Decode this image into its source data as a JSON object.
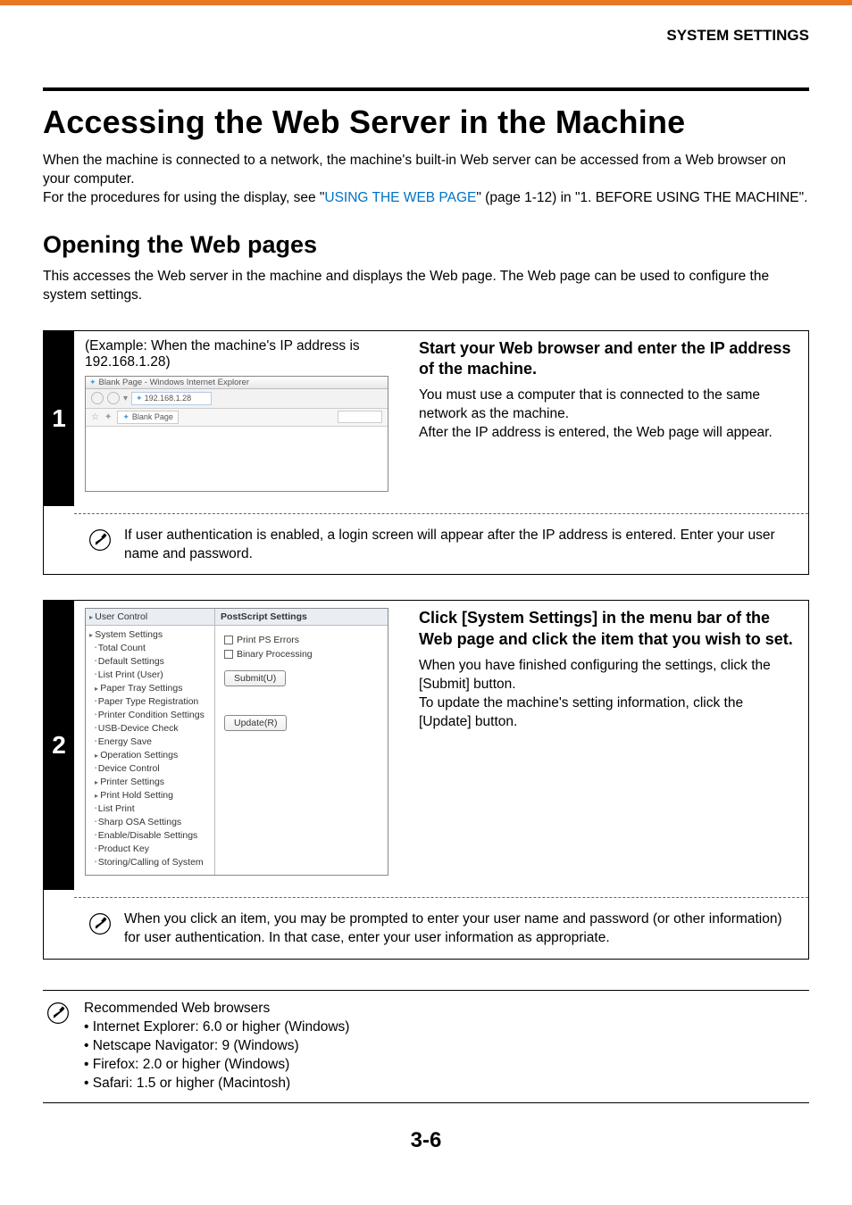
{
  "header": {
    "section": "SYSTEM SETTINGS"
  },
  "title": "Accessing the Web Server in the Machine",
  "intro": {
    "p1": "When the machine is connected to a network, the machine's built-in Web server can be accessed from a Web browser on your computer.",
    "p2a": "For the procedures for using the display, see \"",
    "link": "USING THE WEB PAGE",
    "p2b": "\" (page 1-12) in \"1. BEFORE USING THE MACHINE\"."
  },
  "subheading": "Opening the Web pages",
  "subintro": "This accesses the Web server in the machine and displays the Web page. The Web page can be used to configure the system settings.",
  "step1": {
    "num": "1",
    "example_label": "(Example: When the machine's IP address is 192.168.1.28)",
    "browser": {
      "title": "Blank Page - Windows Internet Explorer",
      "url": "192.168.1.28",
      "tab": "Blank Page"
    },
    "heading": "Start your Web browser and enter the IP address of the machine.",
    "body1": "You must use a computer that is connected to the same network as the machine.",
    "body2": "After the IP address is entered, the Web page will appear.",
    "note": "If user authentication is enabled, a login screen will appear after the IP address is entered. Enter your user name and password."
  },
  "step2": {
    "num": "2",
    "mock": {
      "left_header": "User Control",
      "right_header": "PostScript Settings",
      "menu": [
        {
          "t": "System Settings",
          "cls": "arrow",
          "first": true
        },
        {
          "t": "Total Count",
          "cls": "bullet"
        },
        {
          "t": "Default Settings",
          "cls": "bullet"
        },
        {
          "t": "List Print (User)",
          "cls": "bullet"
        },
        {
          "t": "Paper Tray Settings",
          "cls": "arrow"
        },
        {
          "t": "Paper Type Registration",
          "cls": "bullet"
        },
        {
          "t": "Printer Condition Settings",
          "cls": "bullet"
        },
        {
          "t": "USB-Device Check",
          "cls": "bullet"
        },
        {
          "t": "Energy Save",
          "cls": "bullet"
        },
        {
          "t": "Operation Settings",
          "cls": "arrow"
        },
        {
          "t": "Device Control",
          "cls": "bullet"
        },
        {
          "t": "Printer Settings",
          "cls": "arrow"
        },
        {
          "t": "Print Hold Setting",
          "cls": "arrow"
        },
        {
          "t": "List Print",
          "cls": "bullet"
        },
        {
          "t": "Sharp OSA Settings",
          "cls": "bullet"
        },
        {
          "t": "Enable/Disable Settings",
          "cls": "bullet"
        },
        {
          "t": "Product Key",
          "cls": "bullet"
        },
        {
          "t": "Storing/Calling of System",
          "cls": "bullet"
        }
      ],
      "chk1": "Print PS Errors",
      "chk2": "Binary Processing",
      "btn_submit": "Submit(U)",
      "btn_update": "Update(R)"
    },
    "heading": "Click [System Settings] in the menu bar of the Web page and click the item that you wish to set.",
    "body1": "When you have finished configuring the settings, click the [Submit] button.",
    "body2": "To update the machine's setting information, click the [Update] button.",
    "note": "When you click an item, you may be prompted to enter your user name and password (or other information) for user authentication. In that case, enter your user information as appropriate."
  },
  "recommended": {
    "title": "Recommended Web browsers",
    "items": [
      "Internet Explorer: 6.0 or higher (Windows)",
      "Netscape Navigator: 9 (Windows)",
      "Firefox: 2.0 or higher (Windows)",
      "Safari: 1.5 or higher (Macintosh)"
    ]
  },
  "page_number": "3-6"
}
